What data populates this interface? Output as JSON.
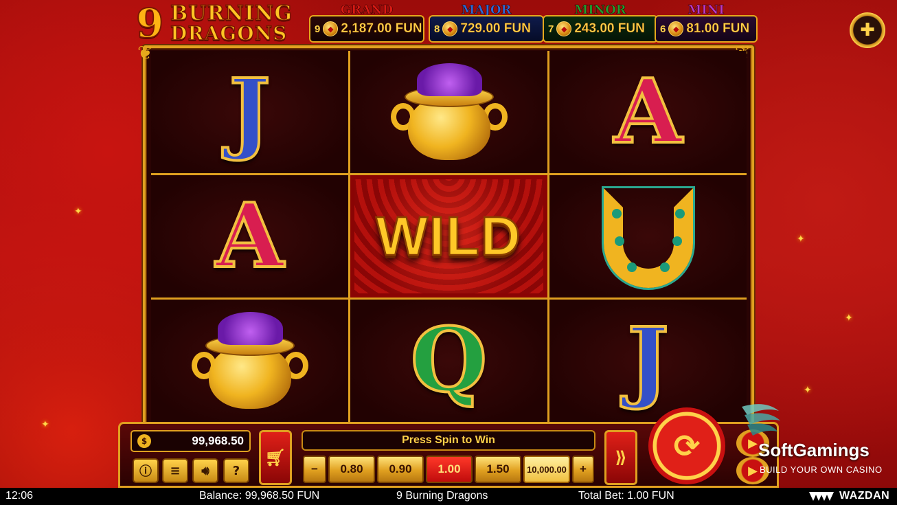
{
  "game": {
    "logo_number": "9",
    "logo_line1": "BURNING",
    "logo_line2": "DRAGONS"
  },
  "jackpots": [
    {
      "title": "GRAND",
      "count": "9",
      "value": "2,187.00 FUN",
      "color": "#d81a14"
    },
    {
      "title": "MAJOR",
      "count": "8",
      "value": "729.00 FUN",
      "color": "#2a6ad8"
    },
    {
      "title": "MINOR",
      "count": "7",
      "value": "243.00 FUN",
      "color": "#20a030"
    },
    {
      "title": "MINI",
      "count": "6",
      "value": "81.00 FUN",
      "color": "#b838c8"
    }
  ],
  "reels": {
    "wild_label": "WILD",
    "symbols": [
      [
        "J",
        "pot",
        "A"
      ],
      [
        "A",
        "wild",
        "horseshoe"
      ],
      [
        "pot",
        "Q",
        "J"
      ]
    ]
  },
  "controls": {
    "balance_value": "99,968.50",
    "message": "Press Spin to Win",
    "bets": [
      "0.80",
      "0.90",
      "1.00",
      "1.50"
    ],
    "selected_bet": "1.00",
    "max_bet": "10,000.00",
    "minus": "−",
    "plus": "+",
    "icons": [
      "info-icon",
      "menu-icon",
      "sound-icon",
      "help-icon",
      "cart-icon",
      "turbo-icon",
      "spin-icon",
      "autoplay-icon"
    ]
  },
  "branding": {
    "softgamings_name": "SoftGamings",
    "softgamings_tagline": "BUILD YOUR OWN CASINO",
    "provider": "WAZDAN"
  },
  "status_bar": {
    "time": "12:06",
    "balance": "Balance: 99,968.50 FUN",
    "title": "9 Burning Dragons",
    "total_bet": "Total Bet: 1.00 FUN"
  }
}
